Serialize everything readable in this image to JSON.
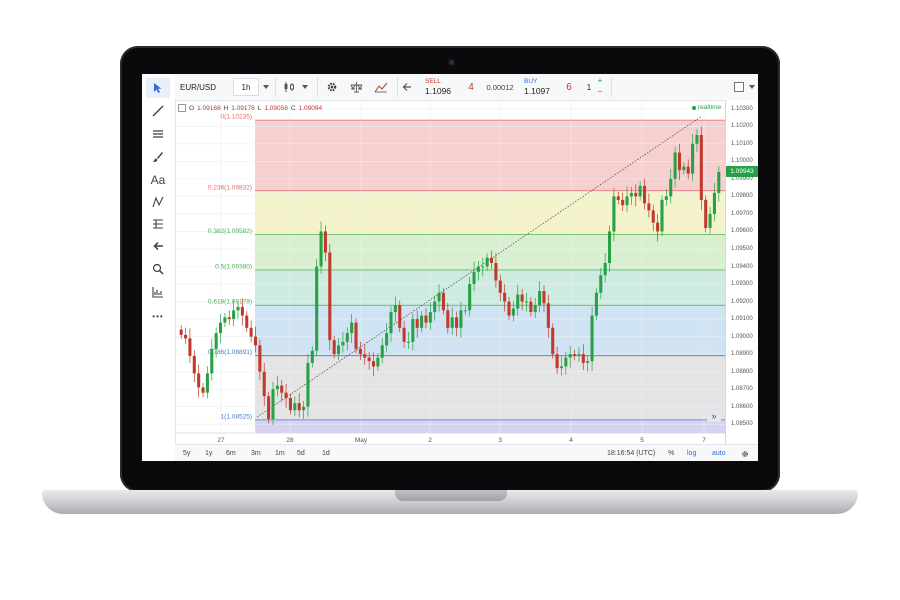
{
  "toolbar": {
    "symbol": "EUR/USD",
    "interval": "1h",
    "sell_label": "SELL",
    "sell_price": "1.1096",
    "sell_pips": "4",
    "spread": "0.00012",
    "buy_label": "BUY",
    "buy_price": "1.1097",
    "buy_pips": "6",
    "quantity": "1",
    "plus": "+",
    "minus": "−"
  },
  "sidebar": {
    "text_tool": "Aa",
    "more": "•••"
  },
  "legend": {
    "o_label": "O",
    "o_value": "1.09168",
    "h_label": "H",
    "h_value": "1.09178",
    "l_label": "L",
    "l_value": "1.09058",
    "c_label": "C",
    "c_value": "1.09094",
    "status": "realtime"
  },
  "fib_labels": [
    "0(1.10235)",
    "0.236(1.09832)",
    "0.382(1.09582)",
    "0.5(1.09380)",
    "0.618(1.09179)",
    "0.786(1.08891)",
    "1(1.08525)"
  ],
  "y_ticks": [
    "1.10300",
    "1.10200",
    "1.10100",
    "1.10000",
    "1.09900",
    "1.09800",
    "1.09700",
    "1.09600",
    "1.09500",
    "1.09400",
    "1.09300",
    "1.09200",
    "1.09100",
    "1.09000",
    "1.08900",
    "1.08800",
    "1.08700",
    "1.08600",
    "1.08500"
  ],
  "last_price": "1.09943",
  "x_ticks": [
    "27",
    "28",
    "May",
    "2",
    "3",
    "4",
    "5",
    "7"
  ],
  "bottom": {
    "ranges": [
      "5y",
      "1y",
      "6m",
      "3m",
      "1m",
      "5d",
      "1d"
    ],
    "time": "18:16:54 (UTC)",
    "percent": "%",
    "log": "log",
    "auto": "auto",
    "scroll": "»"
  },
  "colors": {
    "up": "#27a046",
    "down": "#c0392b",
    "zone_red": "#f6cfcf",
    "zone_yellow": "#f4f3cc",
    "zone_green": "#d8f0d0",
    "zone_teal": "#cdebde",
    "zone_blue": "#cfe3f3",
    "zone_grey": "#e4e4e4",
    "zone_violet": "#d6d3f2",
    "fib_red": "#e06a6a",
    "fib_green": "#4caf50",
    "fib_blue": "#3f7fd1"
  },
  "chart_data": {
    "type": "candlestick",
    "symbol": "EUR/USD",
    "interval": "1h",
    "ylim": [
      1.0845,
      1.1035
    ],
    "fib_retracement": [
      {
        "ratio": 0,
        "price": 1.10235
      },
      {
        "ratio": 0.236,
        "price": 1.09832
      },
      {
        "ratio": 0.382,
        "price": 1.09582
      },
      {
        "ratio": 0.5,
        "price": 1.0938
      },
      {
        "ratio": 0.618,
        "price": 1.09179
      },
      {
        "ratio": 0.786,
        "price": 1.08891
      },
      {
        "ratio": 1,
        "price": 1.08525
      }
    ],
    "close": [
      1.0901,
      1.0899,
      1.0889,
      1.0879,
      1.0871,
      1.0868,
      1.0879,
      1.0893,
      1.0902,
      1.0908,
      1.0911,
      1.091,
      1.0915,
      1.0917,
      1.0912,
      1.0905,
      1.09,
      1.0895,
      1.088,
      1.0866,
      1.0853,
      1.087,
      1.0872,
      1.0868,
      1.0865,
      1.0858,
      1.0862,
      1.0858,
      1.086,
      1.0885,
      1.0892,
      1.094,
      1.096,
      1.0948,
      1.0898,
      1.089,
      1.0895,
      1.0897,
      1.0902,
      1.0908,
      1.0893,
      1.089,
      1.0888,
      1.0886,
      1.0883,
      1.0888,
      1.0895,
      1.0902,
      1.0914,
      1.0918,
      1.0905,
      1.0897,
      1.0897,
      1.091,
      1.0905,
      1.0912,
      1.0908,
      1.0914,
      1.092,
      1.0925,
      1.0915,
      1.0905,
      1.0911,
      1.0905,
      1.0915,
      1.0915,
      1.093,
      1.0937,
      1.094,
      1.094,
      1.0945,
      1.0942,
      1.0932,
      1.0925,
      1.092,
      1.0912,
      1.0916,
      1.0924,
      1.092,
      1.092,
      1.0914,
      1.0918,
      1.0926,
      1.0919,
      1.0905,
      1.089,
      1.0882,
      1.0883,
      1.0888,
      1.089,
      1.0889,
      1.089,
      1.0885,
      1.0886,
      1.0912,
      1.0925,
      1.0935,
      1.0942,
      1.096,
      1.098,
      1.0978,
      1.0975,
      1.098,
      1.0982,
      1.098,
      1.0986,
      1.0976,
      1.0972,
      1.0965,
      1.096,
      1.0978,
      1.098,
      1.099,
      1.1005,
      1.0995,
      1.0997,
      1.0993,
      1.101,
      1.1015,
      1.0978,
      1.0962,
      1.097,
      1.0982,
      1.0994
    ]
  }
}
